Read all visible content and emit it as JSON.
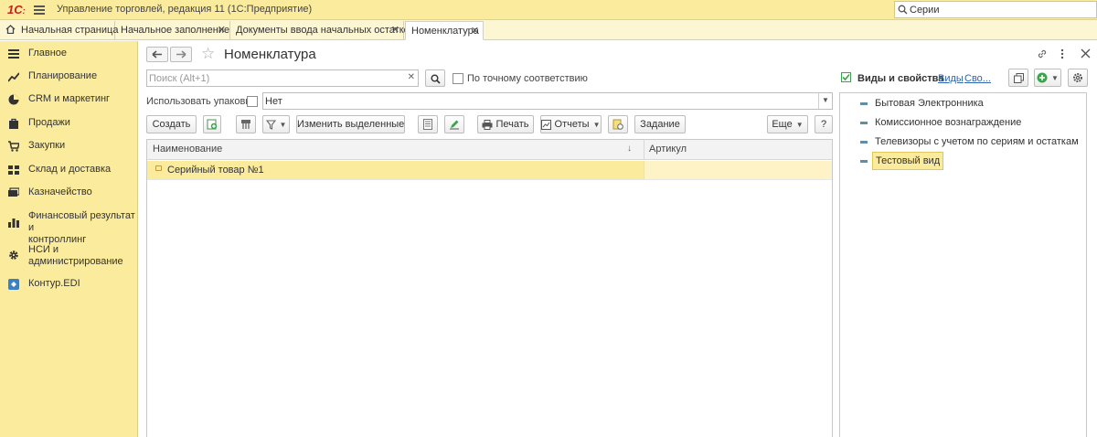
{
  "window": {
    "logo": "1С",
    "title": "Управление торговлей, редакция 11  (1С:Предприятие)",
    "search_value": "Серии"
  },
  "tabs": [
    {
      "label": "Начальная страница"
    },
    {
      "label": "Начальное заполнение"
    },
    {
      "label": "Документы ввода начальных остатков"
    },
    {
      "label": "Номенклатура"
    }
  ],
  "sidebar": {
    "items": [
      {
        "label": "Главное",
        "icon": "list-icon"
      },
      {
        "label": "Планирование",
        "icon": "chart-icon"
      },
      {
        "label": "CRM и маркетинг",
        "icon": "pie-icon"
      },
      {
        "label": "Продажи",
        "icon": "bag-icon"
      },
      {
        "label": "Закупки",
        "icon": "cart-icon"
      },
      {
        "label": "Склад и доставка",
        "icon": "warehouse-icon"
      },
      {
        "label": "Казначейство",
        "icon": "money-icon"
      },
      {
        "label": "Финансовый результат и\nконтроллинг",
        "icon": "bar-chart-icon"
      },
      {
        "label": "НСИ и\nадминистрирование",
        "icon": "gear-icon"
      },
      {
        "label": "Контур.EDI",
        "icon": "edi-icon"
      }
    ]
  },
  "form": {
    "title": "Номенклатура",
    "search_placeholder": "Поиск (Alt+1)",
    "exact_match_label": "По точному соответствию",
    "use_packages_label": "Использовать упаковки:",
    "use_packages_value": "Нет"
  },
  "toolbar": {
    "create": "Создать",
    "edit_selected": "Изменить выделенные",
    "print": "Печать",
    "reports": "Отчеты",
    "task": "Задание",
    "more": "Еще",
    "help": "?"
  },
  "table": {
    "columns": [
      "Наименование",
      "Артикул"
    ],
    "rows": [
      {
        "name": "Серийный товар №1",
        "article": ""
      }
    ]
  },
  "right_panel": {
    "title": "Виды и свойства",
    "link_kinds": "Виды",
    "link_props": "Сво...",
    "items": [
      {
        "label": "Бытовая Электронника"
      },
      {
        "label": "Комиссионное вознаграждение"
      },
      {
        "label": "Телевизоры с учетом по сериям и остаткам"
      },
      {
        "label": "Тестовый вид"
      }
    ]
  },
  "colors": {
    "accent_yellow": "#fbeb9c",
    "link_blue": "#2d64b3",
    "add_green": "#3aa54a"
  }
}
